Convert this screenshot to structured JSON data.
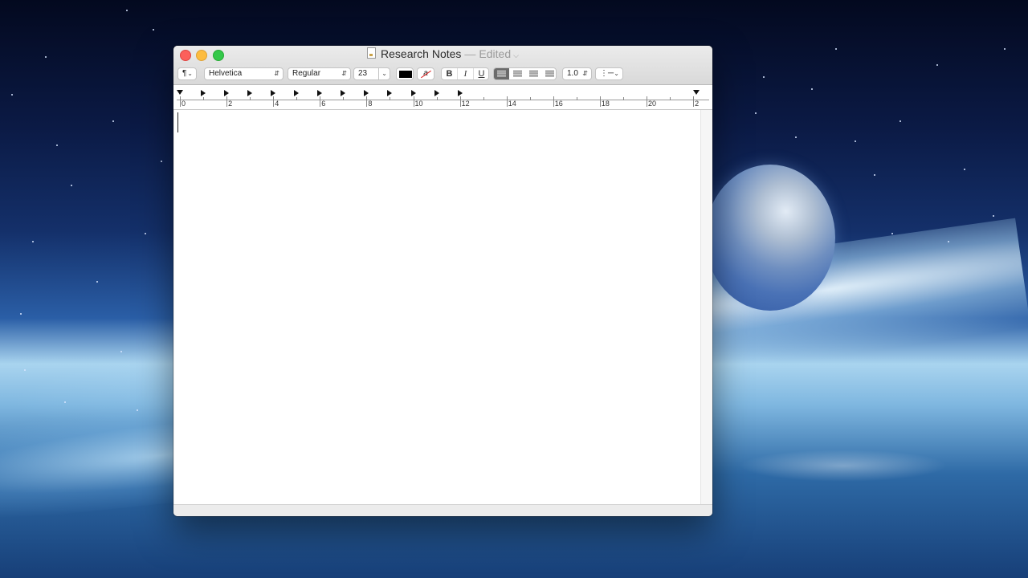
{
  "window": {
    "title": "Research Notes",
    "separator": "—",
    "status": "Edited",
    "title_menu_chevron": "chevron-down-icon"
  },
  "toolbar": {
    "paragraph_style_symbol": "¶",
    "font_family": "Helvetica",
    "font_style": "Regular",
    "font_size": "23",
    "text_color": "#000000",
    "bold_label": "B",
    "italic_label": "I",
    "underline_label": "U",
    "alignment_options": [
      "left",
      "center",
      "right",
      "justify"
    ],
    "selected_alignment": "left",
    "line_spacing": "1.0",
    "list_icon": "list-bullets-icon"
  },
  "ruler": {
    "labels": [
      "0",
      "2",
      "4",
      "6",
      "8",
      "10",
      "12",
      "14",
      "16",
      "18",
      "20",
      "2"
    ]
  },
  "colors": {
    "close": "#fc605b",
    "minimize": "#fdbc40",
    "zoom": "#34c84a",
    "active_segment": "#6b6b6b"
  }
}
